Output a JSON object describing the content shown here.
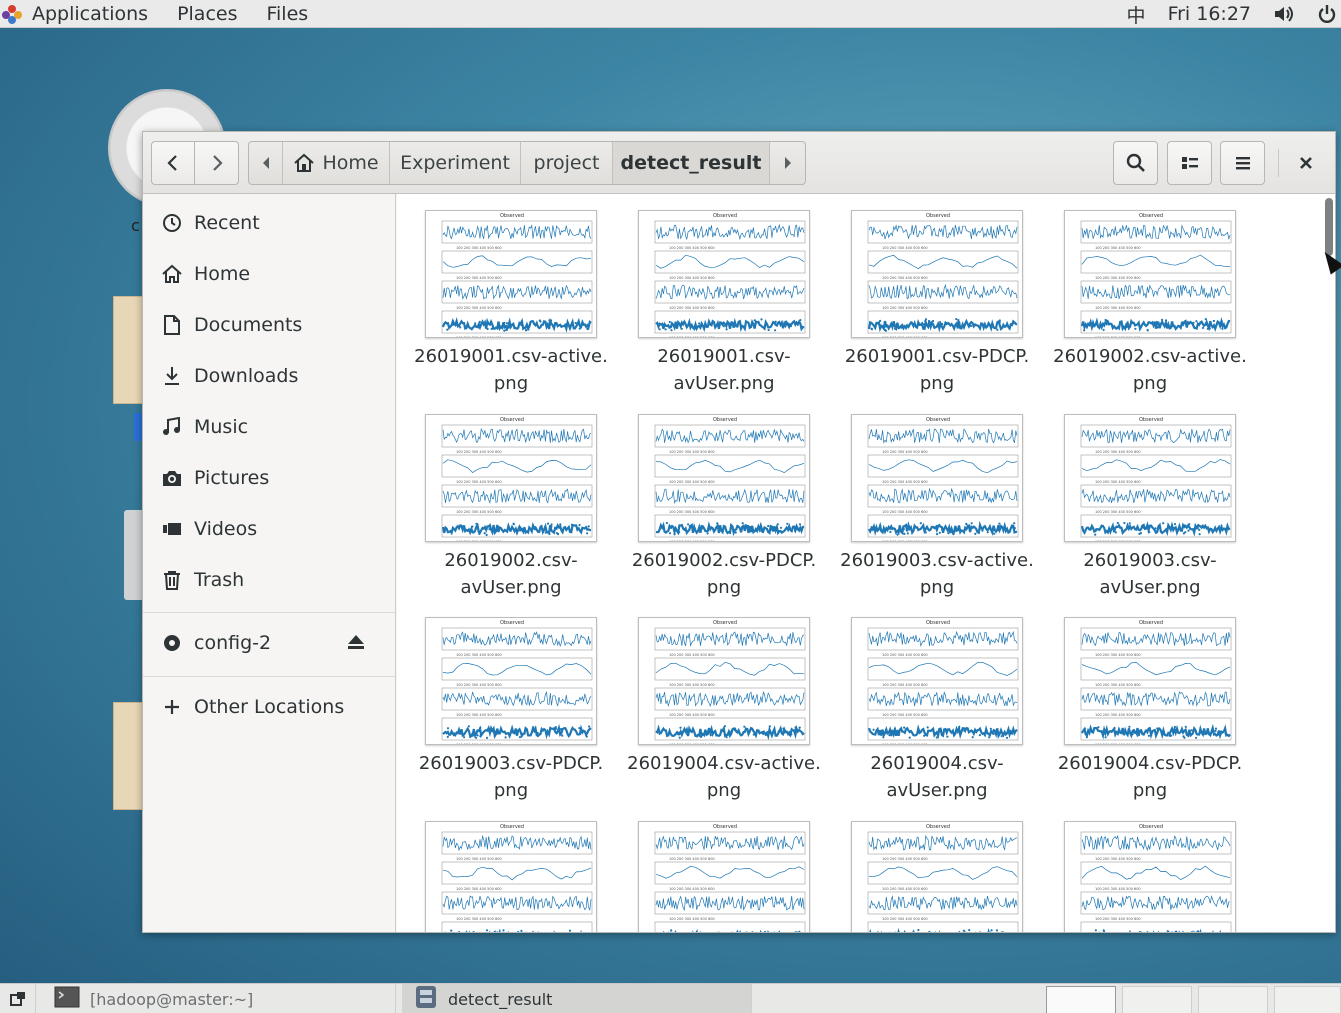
{
  "topbar": {
    "applications": "Applications",
    "places": "Places",
    "files": "Files",
    "input_method": "中",
    "clock": "Fri 16:27"
  },
  "desktop": {
    "partial_label": "c"
  },
  "window": {
    "pathbar": {
      "segments": [
        "Home",
        "Experiment",
        "project",
        "detect_result"
      ]
    },
    "sidebar": {
      "items": [
        "Recent",
        "Home",
        "Documents",
        "Downloads",
        "Music",
        "Pictures",
        "Videos",
        "Trash"
      ],
      "devices": [
        "config-2"
      ],
      "other": "Other Locations"
    },
    "files": [
      "26019001.csv-active.png",
      "26019001.csv-avUser.png",
      "26019001.csv-PDCP.png",
      "26019002.csv-active.png",
      "26019002.csv-avUser.png",
      "26019002.csv-PDCP.png",
      "26019003.csv-active.png",
      "26019003.csv-avUser.png",
      "26019003.csv-PDCP.png",
      "26019004.csv-active.png",
      "26019004.csv-avUser.png",
      "26019004.csv-PDCP.png",
      "",
      "",
      "",
      ""
    ],
    "file_labels": [
      [
        "26019001.csv-active.",
        "png"
      ],
      [
        "26019001.csv-",
        "avUser.png"
      ],
      [
        "26019001.csv-PDCP.",
        "png"
      ],
      [
        "26019002.csv-active.",
        "png"
      ],
      [
        "26019002.csv-",
        "avUser.png"
      ],
      [
        "26019002.csv-PDCP.",
        "png"
      ],
      [
        "26019003.csv-active.",
        "png"
      ],
      [
        "26019003.csv-",
        "avUser.png"
      ],
      [
        "26019003.csv-PDCP.",
        "png"
      ],
      [
        "26019004.csv-active.",
        "png"
      ],
      [
        "26019004.csv-",
        "avUser.png"
      ],
      [
        "26019004.csv-PDCP.",
        "png"
      ]
    ]
  },
  "taskbar": {
    "terminal": "[hadoop@master:~]",
    "files_window": "detect_result"
  },
  "colors": {
    "plot_line": "#1f77b4",
    "desktop_bg": "#3d85a4"
  }
}
